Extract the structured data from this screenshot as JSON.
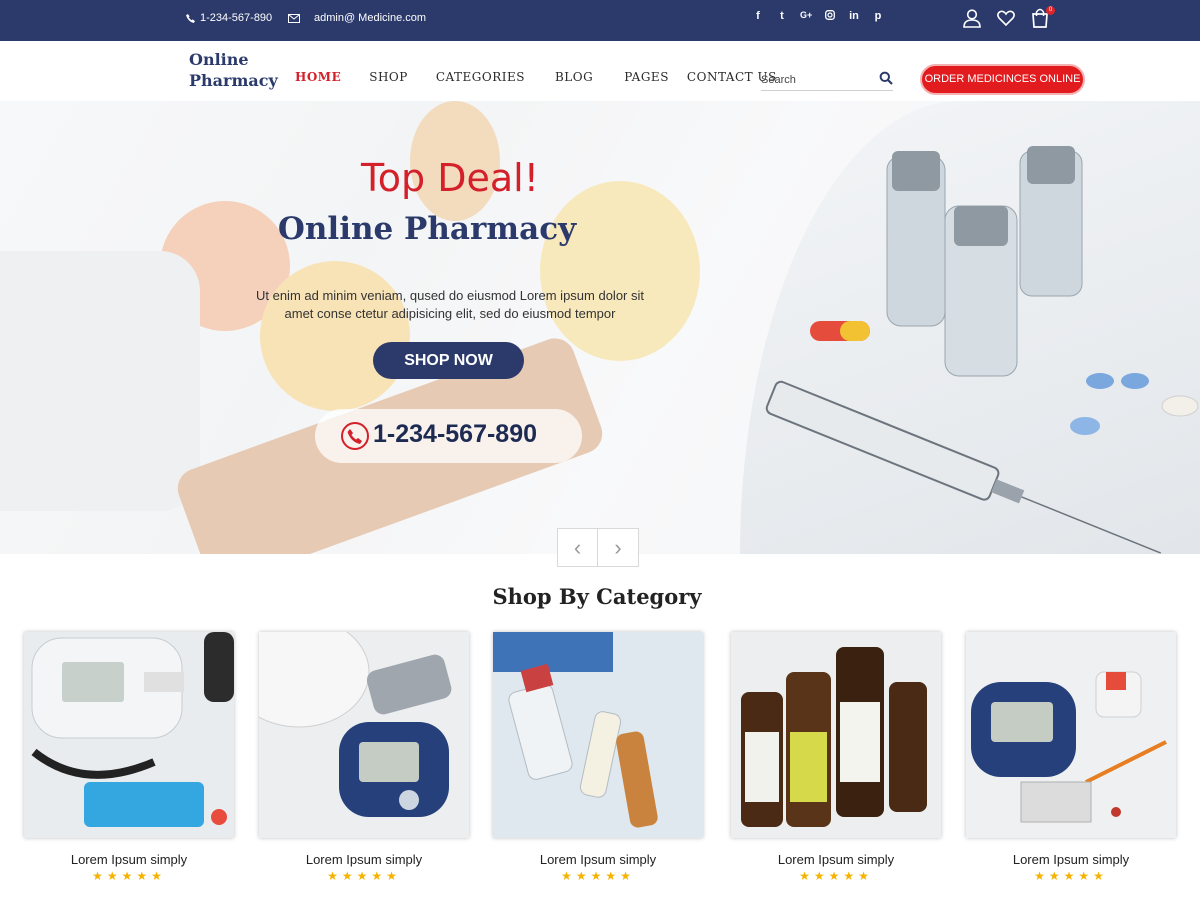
{
  "topbar": {
    "phone": "1-234-567-890",
    "email": "admin@ Medicine.com",
    "social": [
      "f",
      "t",
      "G+",
      "ig",
      "in",
      "p"
    ],
    "cart_count": "0",
    "icons": [
      "user-icon",
      "heart-icon",
      "cart-icon"
    ]
  },
  "header": {
    "logo_line1": "Online",
    "logo_line2": "Pharmacy",
    "nav": [
      "HOME",
      "SHOP",
      "CATEGORIES",
      "BLOG",
      "PAGES",
      "CONTACT US"
    ],
    "search_placeholder": "Search",
    "order_button": "ORDER MEDICINCES ONLINE"
  },
  "hero": {
    "title": "Top Deal!",
    "subtitle": "Online Pharmacy",
    "text_line1": "Ut enim ad minim veniam, qused do eiusmod  Lorem ipsum dolor sit",
    "text_line2": "amet conse ctetur adipisicing elit, sed do eiusmod tempor",
    "button": "SHOP NOW",
    "phone": "1-234-567-890",
    "prev": "‹",
    "next": "›"
  },
  "categories": {
    "title": "Shop By Category",
    "items": [
      {
        "label": "Lorem Ipsum simply",
        "rating": 5
      },
      {
        "label": "Lorem Ipsum simply",
        "rating": 5
      },
      {
        "label": "Lorem Ipsum simply",
        "rating": 5
      },
      {
        "label": "Lorem Ipsum simply",
        "rating": 5
      },
      {
        "label": "Lorem Ipsum simply",
        "rating": 5
      }
    ],
    "stars": "★★★★★"
  },
  "colors": {
    "brand": "#2b3a6b",
    "accent": "#d4202a",
    "star": "#f5b301"
  }
}
